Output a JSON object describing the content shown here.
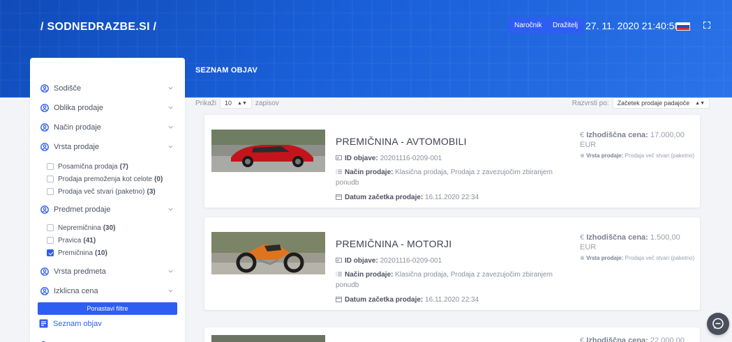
{
  "header": {
    "logo": "/ SODNEDRAZBE.SI /",
    "btn_narocnik": "Naročnik",
    "btn_drazitelj": "Dražitelj",
    "datetime": "27. 11. 2020 21:40:58",
    "flag_icon": "slovenia-flag-icon",
    "fullscreen_icon": "fullscreen-icon"
  },
  "page": {
    "title": "SEZNAM OBJAV"
  },
  "colors": {
    "primary": "#2e5df2",
    "hero": "#1a5fd8",
    "sidebar_icon": "#2e5df2"
  },
  "sidebar": {
    "sections": [
      {
        "label": "Sodišče"
      },
      {
        "label": "Oblika prodaje"
      },
      {
        "label": "Način prodaje"
      },
      {
        "label": "Vrsta prodaje"
      },
      {
        "label": "Predmet prodaje"
      },
      {
        "label": "Vrsta predmeta"
      },
      {
        "label": "Izklicna cena"
      }
    ],
    "vrsta_options": [
      {
        "label": "Posamična prodaja",
        "count": "(7)",
        "checked": false
      },
      {
        "label": "Prodaja premoženja kot celote",
        "count": "(0)",
        "checked": false
      },
      {
        "label": "Prodaja več stvari (paketno)",
        "count": "(3)",
        "checked": false
      }
    ],
    "predmet_options": [
      {
        "label": "Nepremičnina",
        "count": "(30)",
        "checked": false
      },
      {
        "label": "Pravica",
        "count": "(41)",
        "checked": false
      },
      {
        "label": "Premičnina",
        "count": "(10)",
        "checked": true
      }
    ],
    "reset_label": "Ponastavi filtre",
    "nav_label": "Seznam objav"
  },
  "toolbar": {
    "show_prefix": "Prikaži",
    "show_value": "10",
    "show_suffix": "zapisov",
    "sort_prefix": "Razvrsti po:",
    "sort_value": "Začetek prodaje padajoče"
  },
  "listings": [
    {
      "title": "PREMIČNINA - AVTOMOBILI",
      "id_label": "ID objave:",
      "id_value": "20201116-0209-001",
      "nacin_label": "Način prodaje:",
      "nacin_value": "Klasična prodaja, Prodaja z zavezujočim zbiranjem ponudb",
      "datum_label": "Datum začetka prodaje:",
      "datum_value": "16.11.2020 22:34",
      "price_label": "Izhodiščna cena:",
      "price_value": "17.000,00 EUR",
      "vrsta_label": "Vrsta prodaje:",
      "vrsta_value": "Prodaja več stvari (paketno)",
      "thumb": "red-car-photo"
    },
    {
      "title": "PREMIČNINA - MOTORJI",
      "id_label": "ID objave:",
      "id_value": "20201116-0209-001",
      "nacin_label": "Način prodaje:",
      "nacin_value": "Klasična prodaja, Prodaja z zavezujočim zbiranjem ponudb",
      "datum_label": "Datum začetka prodaje:",
      "datum_value": "16.11.2020 22:34",
      "price_label": "Izhodiščna cena:",
      "price_value": "1.500,00 EUR",
      "vrsta_label": "Vrsta prodaje:",
      "vrsta_value": "Prodaja več stvari (paketno)",
      "thumb": "orange-motorcycle-photo"
    },
    {
      "price_label": "Izhodiščna cena:",
      "price_value": "22.000,00"
    }
  ]
}
